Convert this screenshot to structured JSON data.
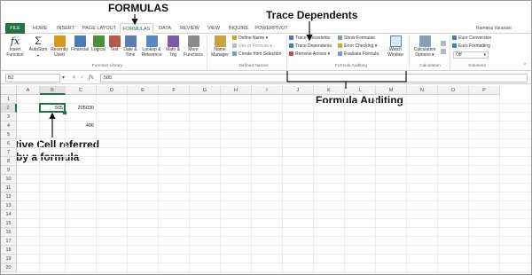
{
  "annotations": {
    "formulas": "FORMULAS",
    "trace_dependents": "Trace Dependents",
    "formula_auditing": "Formula Auditing",
    "active_cell_line1": "Active Cell referred",
    "active_cell_line2": "by a formula"
  },
  "tabs": [
    "FILE",
    "HOME",
    "INSERT",
    "PAGE LAYOUT",
    "FORMULAS",
    "DATA",
    "REVIEW",
    "VIEW",
    "INQUIRE",
    "POWERPIVOT"
  ],
  "user": "Ramana Varanasi",
  "ribbon": {
    "insert_function": [
      "Insert",
      "Function"
    ],
    "autosum": [
      "AutoSum"
    ],
    "recently_used": [
      "Recently",
      "Used"
    ],
    "financial": [
      "Financial"
    ],
    "logical": [
      "Logical"
    ],
    "text": [
      "Text"
    ],
    "date_time": [
      "Date &",
      "Time"
    ],
    "lookup": [
      "Lookup &",
      "Reference"
    ],
    "math": [
      "Math &",
      "Trig"
    ],
    "more_functions": [
      "More",
      "Functions"
    ],
    "name_manager": [
      "Name",
      "Manager"
    ],
    "define_name": "Define Name",
    "use_in_formula": "Use in Formula",
    "create_from_selection": "Create from Selection",
    "trace_precedents": "Trace Precedents",
    "trace_dependents": "Trace Dependents",
    "remove_arrows": "Remove Arrows",
    "show_formulas": "Show Formulas",
    "error_checking": "Error Checking",
    "evaluate_formula": "Evaluate Formula",
    "watch_window": [
      "Watch",
      "Window"
    ],
    "calc_options": [
      "Calculation",
      "Options"
    ],
    "euro_conversion": "Euro Conversion",
    "euro_formatting": "Euro Formatting",
    "off": "Off",
    "groups": {
      "function_library": "Function Library",
      "defined_names": "Defined Names",
      "formula_auditing": "Formula Auditing",
      "calculation": "Calculation",
      "solutions": "Solutions"
    }
  },
  "formula_bar": {
    "name_box": "B2",
    "fx": "fx",
    "value": "505"
  },
  "columns": [
    "A",
    "B",
    "C",
    "D",
    "E",
    "F",
    "G",
    "H",
    "I",
    "J",
    "K",
    "L",
    "M",
    "N",
    "O",
    "P"
  ],
  "rows": [
    "1",
    "2",
    "3",
    "4",
    "5",
    "6",
    "7",
    "8",
    "9",
    "10",
    "11",
    "12",
    "13",
    "14",
    "15",
    "16",
    "17",
    "18",
    "19",
    "20"
  ],
  "cells": {
    "B2": "505",
    "C2": "205030",
    "C4": "406"
  },
  "colors": {
    "accent": "#217346"
  }
}
